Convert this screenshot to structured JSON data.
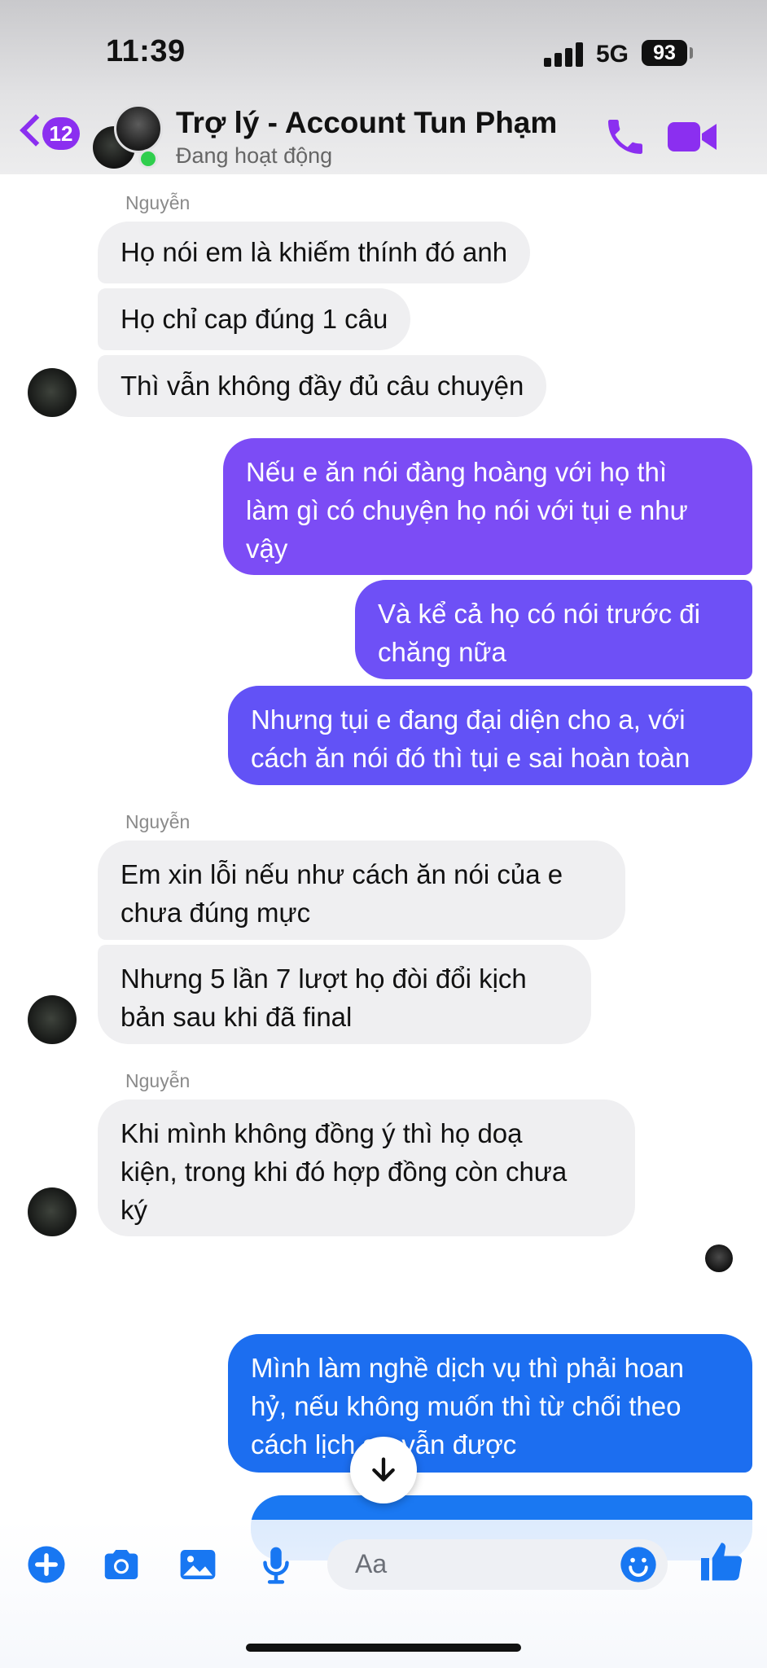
{
  "status_bar": {
    "time": "11:39",
    "network": "5G",
    "battery": "93"
  },
  "header": {
    "back_badge": "12",
    "contact_name": "Trợ lý - Account Tun Phạm",
    "contact_status": "Đang hoạt động",
    "call_icon": "phone-icon",
    "video_icon": "video-camera-icon"
  },
  "messages": {
    "group1": {
      "sender": "Nguyễn",
      "lines": [
        "Họ nói em là khiếm thính đó anh",
        "Họ chỉ cap đúng 1 câu",
        "Thì vẫn không đầy đủ câu chuyện"
      ]
    },
    "group2": {
      "m1": [
        "Nếu e ăn nói đàng hoàng với họ thì",
        "làm gì có chuyện họ nói với tụi e như",
        "vậy"
      ],
      "m2": [
        "Và kể cả họ có nói trước đi",
        "chăng nữa"
      ],
      "m3": [
        "Nhưng tụi e đang đại diện cho a, với",
        "cách ăn nói đó thì tụi e sai hoàn toàn"
      ]
    },
    "group3": {
      "sender": "Nguyễn",
      "m1": [
        "Em xin lỗi nếu như cách ăn nói của e",
        "chưa đúng mực"
      ],
      "m2": [
        "Nhưng 5 lần 7 lượt họ đòi đổi kịch",
        "bản sau khi đã final"
      ]
    },
    "group4": {
      "sender": "Nguyễn",
      "m1": [
        "Khi mình không đồng ý thì họ doạ",
        "kiện, trong khi đó hợp đồng còn chưa",
        "ký"
      ]
    },
    "group5": {
      "m1": [
        "Mình làm nghề dịch vụ thì phải hoan",
        "hỷ, nếu không muốn thì từ chối theo",
        "cách lịch sự vẫn được"
      ]
    }
  },
  "composer": {
    "placeholder": "Aa"
  },
  "colors": {
    "accent": "#8b2ff0",
    "incoming": "#efeff1",
    "online": "#2fce4d",
    "messenger_blue": "#1877f2"
  }
}
